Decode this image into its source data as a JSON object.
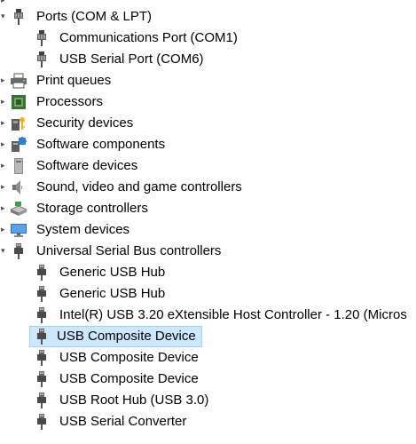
{
  "tree": {
    "ports": {
      "label": "Ports (COM & LPT)",
      "icon": "port-connector-icon",
      "expanded": true,
      "children": [
        {
          "label": "Communications Port (COM1)",
          "icon": "port-connector-icon"
        },
        {
          "label": "USB Serial Port (COM6)",
          "icon": "port-connector-icon"
        }
      ]
    },
    "categories": [
      {
        "label": "Print queues",
        "icon": "printer-icon"
      },
      {
        "label": "Processors",
        "icon": "processor-chip-icon"
      },
      {
        "label": "Security devices",
        "icon": "key-lock-icon"
      },
      {
        "label": "Software components",
        "icon": "puzzle-component-icon"
      },
      {
        "label": "Software devices",
        "icon": "software-device-icon"
      },
      {
        "label": "Sound, video and game controllers",
        "icon": "speaker-icon"
      },
      {
        "label": "Storage controllers",
        "icon": "storage-controller-icon"
      },
      {
        "label": "System devices",
        "icon": "system-monitor-icon"
      }
    ],
    "usb": {
      "label": "Universal Serial Bus controllers",
      "icon": "usb-plug-icon",
      "expanded": true,
      "children": [
        {
          "label": "Generic USB Hub",
          "icon": "usb-plug-icon"
        },
        {
          "label": "Generic USB Hub",
          "icon": "usb-plug-icon"
        },
        {
          "label": "Intel(R) USB 3.20 eXtensible Host Controller - 1.20 (Micros",
          "icon": "usb-plug-icon"
        },
        {
          "label": "USB Composite Device",
          "icon": "usb-plug-icon",
          "selected": true
        },
        {
          "label": "USB Composite Device",
          "icon": "usb-plug-icon"
        },
        {
          "label": "USB Composite Device",
          "icon": "usb-plug-icon"
        },
        {
          "label": "USB Root Hub (USB 3.0)",
          "icon": "usb-plug-icon"
        },
        {
          "label": "USB Serial Converter",
          "icon": "usb-plug-icon"
        }
      ]
    }
  },
  "colors": {
    "selection_bg": "#cce8ff",
    "selection_border": "#99d1ff",
    "chevron": "#505050"
  }
}
